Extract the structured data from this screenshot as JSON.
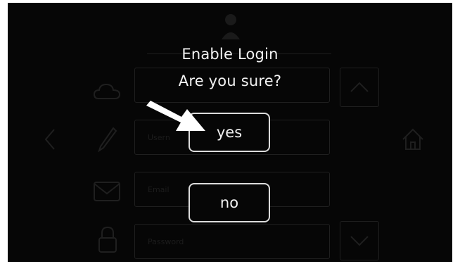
{
  "dialog": {
    "title": "Enable Login",
    "question": "Are you sure?",
    "yes_label": "yes",
    "no_label": "no"
  },
  "background": {
    "field_placeholder_2": "Usern",
    "field_placeholder_3": "Email",
    "field_placeholder_4": "Password"
  },
  "colors": {
    "screen_background": "#060606",
    "text": "#f2f2f2",
    "button_border": "#dcdcdc",
    "pointer_arrow": "#ffffff"
  },
  "icons": {
    "top": "user-icon",
    "row1": "cloud-icon",
    "row2": "pen-icon",
    "row3": "envelope-icon",
    "row4": "lock-icon",
    "left": "chevron-left-icon",
    "right": "home-icon",
    "scroll_up": "chevron-up-icon",
    "scroll_down": "chevron-down-icon"
  }
}
